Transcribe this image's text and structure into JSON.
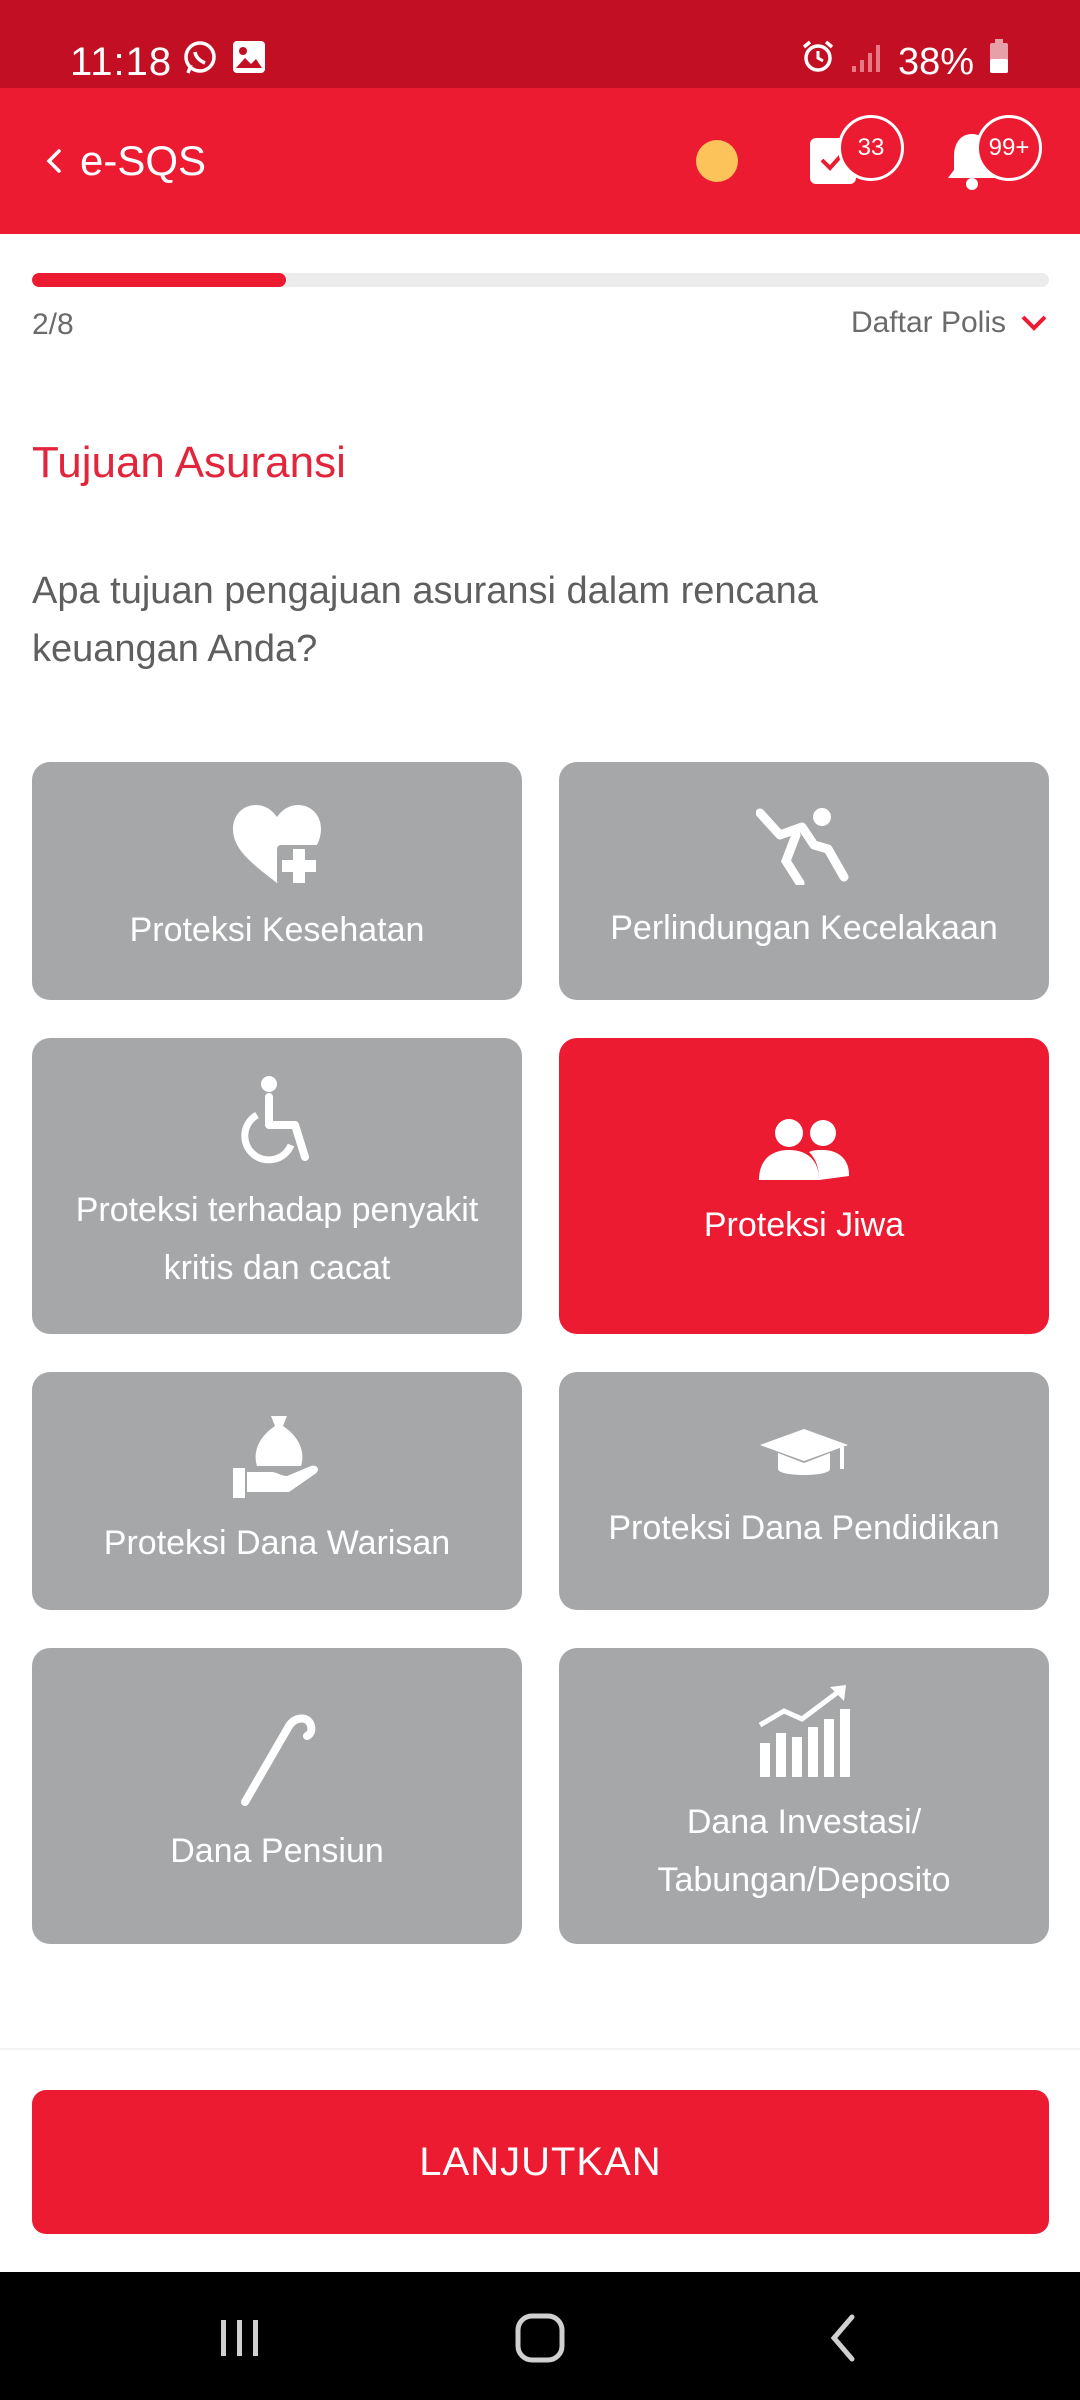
{
  "status_bar": {
    "time": "11:18",
    "battery": "38%",
    "icons": [
      "whatsapp-icon",
      "gallery-icon",
      "alarm-icon",
      "signal-icon",
      "battery-icon"
    ]
  },
  "app_bar": {
    "title": "e-SQS",
    "task_count": "33",
    "notification_count": "99+"
  },
  "progress": {
    "step": "2/8",
    "fraction": 0.25,
    "policy_toggle_label": "Daftar Polis"
  },
  "main": {
    "section_title": "Tujuan Asuransi",
    "question": "Apa tujuan pengajuan asuransi dalam rencana keuangan Anda?",
    "options": [
      {
        "label": "Proteksi Kesehatan",
        "icon": "heart-plus-icon",
        "selected": false
      },
      {
        "label": "Perlindungan Kecelakaan",
        "icon": "falling-person-icon",
        "selected": false
      },
      {
        "label": "Proteksi terhadap penyakit kritis dan cacat",
        "icon": "wheelchair-icon",
        "selected": false
      },
      {
        "label": "Proteksi Jiwa",
        "icon": "people-icon",
        "selected": true
      },
      {
        "label": "Proteksi Dana Warisan",
        "icon": "money-bag-hand-icon",
        "selected": false
      },
      {
        "label": "Proteksi Dana Pendidikan",
        "icon": "graduation-cap-icon",
        "selected": false
      },
      {
        "label": "Dana Pensiun",
        "icon": "walking-cane-icon",
        "selected": false
      },
      {
        "label": "Dana Investasi/ Tabungan/Deposito",
        "icon": "growth-chart-icon",
        "selected": false
      }
    ]
  },
  "footer": {
    "cta_label": "LANJUTKAN"
  },
  "colors": {
    "primary": "#ED1B32",
    "status_bar": "#C30F23",
    "option_inactive": "#A6A7A9",
    "status_dot": "#FCC35A"
  }
}
